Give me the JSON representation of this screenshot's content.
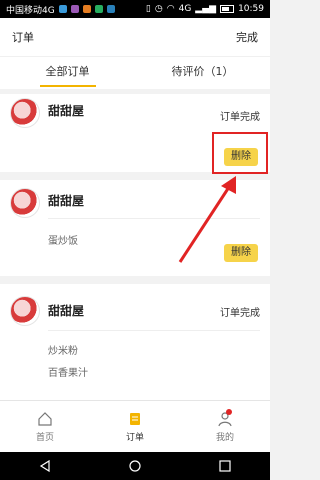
{
  "status_bar": {
    "carrier": "中国移动4G",
    "notification": "4G",
    "time": "10:59"
  },
  "header": {
    "title": "订单",
    "action": "完成"
  },
  "tabs": [
    {
      "label": "全部订单"
    },
    {
      "label": "待评价（1）"
    }
  ],
  "orders": [
    {
      "shop": "甜甜屋",
      "status": "订单完成",
      "items": [],
      "button": "删除"
    },
    {
      "shop": "甜甜屋",
      "status": "",
      "items": [
        "蛋炒饭"
      ],
      "button": "删除"
    },
    {
      "shop": "甜甜屋",
      "status": "订单完成",
      "items": [
        "炒米粉",
        "百香果汁"
      ],
      "button": ""
    }
  ],
  "bottom_nav": [
    {
      "label": "首页",
      "icon": "home-icon"
    },
    {
      "label": "订单",
      "icon": "orders-icon"
    },
    {
      "label": "我的",
      "icon": "profile-icon"
    }
  ],
  "colors": {
    "accent": "#f3b400",
    "button": "#f6d34a",
    "annotation": "#e12424"
  }
}
